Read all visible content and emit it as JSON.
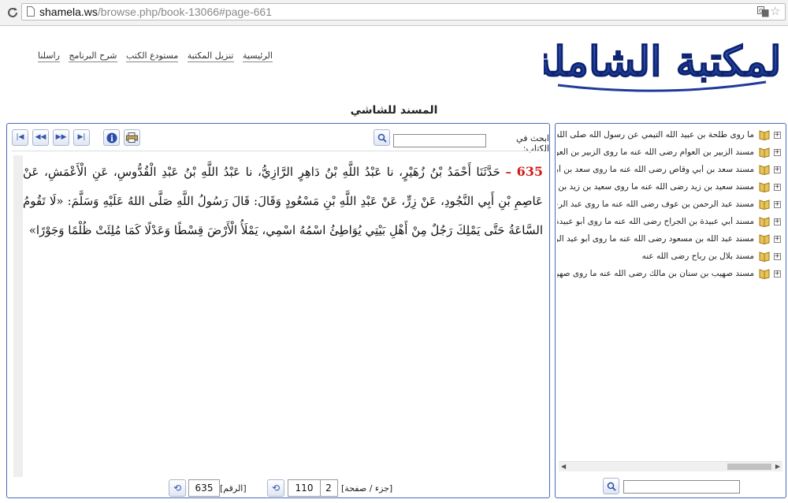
{
  "browser": {
    "url_host": "shamela.ws",
    "url_path": "/browse.php/book-13066#page-661"
  },
  "site": {
    "logo_text": "المكتبة الشاملة",
    "nav": [
      "الرئيسية",
      "تنزيل المكتبة",
      "مستودع الكتب",
      "شرح البرنامج",
      "راسلنا"
    ],
    "book_title": "المسند للشاشي"
  },
  "toolbar": {
    "search_label": "ابحث في الكتاب:",
    "search_value": "",
    "first_icon": "first-page-icon",
    "prev_icon": "previous-page-icon",
    "next_icon": "next-page-icon",
    "last_icon": "last-page-icon",
    "info_icon": "info-icon",
    "print_icon": "printer-icon"
  },
  "content": {
    "hadith_number": "635",
    "dash": "–",
    "text": "حَدَّثَنَا أَحْمَدُ بْنُ زُهَيْرٍ، نا عَبْدُ اللَّهِ بْنُ دَاهِرٍ الرَّازِيُّ، نا عَبْدُ اللَّهِ بْنُ عَبْدِ الْقُدُّوسِ، عَنِ الْأَعْمَشِ، عَنْ عَاصِمِ بْنِ أَبِي النَّجُودِ، عَنْ زِرٍّ، عَنْ عَبْدِ اللَّهِ بْنِ مَسْعُودٍ وَقَالَ: قَالَ رَسُولُ اللَّهِ صَلَّى اللهُ عَلَيْهِ وَسَلَّمَ: «لَا تَقُومُ السَّاعَةُ حَتَّى يَمْلِكَ رَجُلٌ مِنْ أَهْلِ بَيْتِي يُوَاطِئُ اسْمُهُ اسْمِي، يَمْلَأُ الْأَرْضَ قِسْطًا وَعَدْلًا كَمَا مُلِئَتْ ظُلْمًا وَجَوْرًا»"
  },
  "footer": {
    "part_page_label": "[جزء / صفحة]",
    "part": "2",
    "page": "110",
    "number_label": "[الرقم]",
    "number": "635"
  },
  "tree": {
    "items": [
      "ما روى طلحة بن عبيد الله التيمي عن رسول الله صلى الله عليه وسلم",
      "مسند الزبير بن العوام رضى الله عنه ما روى الزبير بن العوام",
      "مسند سعد بن أبي وقاص رضى الله عنه ما روى سعد بن أبي وقاص",
      "مسند سعيد بن زيد رضى الله عنه ما روى سعيد بن زيد بن عمرو",
      "مسند عبد الرحمن بن عوف رضى الله عنه ما روى عبد الرحمن",
      "مسند أبي عبيدة بن الجراح رضى الله عنه ما روى أبو عبيدة",
      "مسند عبد الله بن مسعود رضى الله عنه ما روى أبو عبد الرحمن",
      "مسند بلال بن رباح رضى الله عنه",
      "مسند صهيب بن سنان بن مالك رضى الله عنه ما روى صهيب"
    ],
    "search_value": ""
  },
  "colors": {
    "panel_border": "#4a6bb5",
    "hadith_number": "#d11a1a",
    "logo_blue": "#1f3a9a"
  }
}
